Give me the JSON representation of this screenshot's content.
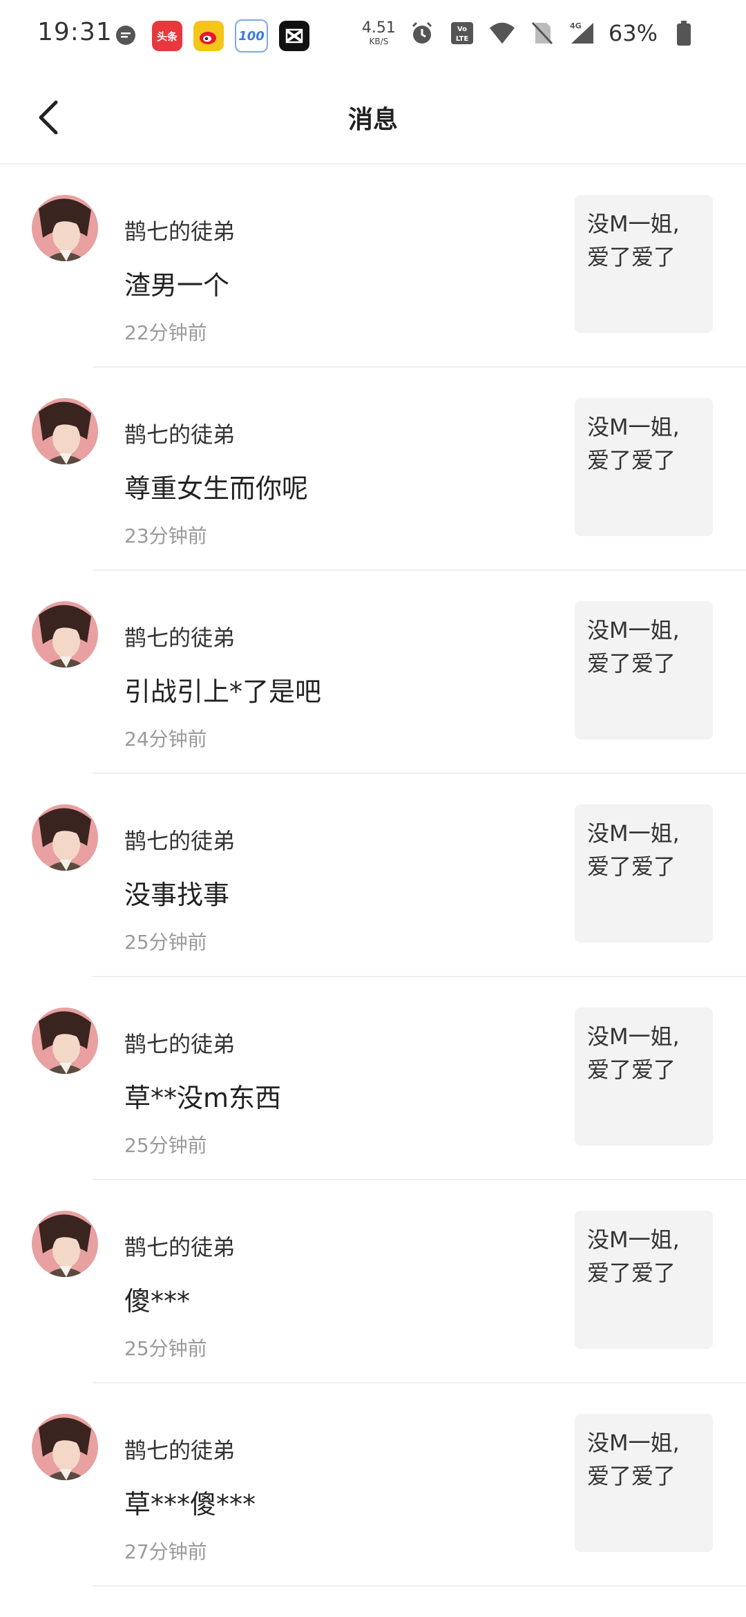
{
  "status_bar": {
    "time": "19:31",
    "net_speed_value": "4.51",
    "net_speed_unit": "KB/S",
    "battery": "63%",
    "app_icons": [
      "message-icon",
      "toutiao-icon",
      "weibo-icon",
      "baidu-100-icon",
      "capcut-icon"
    ],
    "app_labels": {
      "toutiao": "头条",
      "baidu": "100"
    }
  },
  "header": {
    "title": "消息"
  },
  "messages": [
    {
      "username": "鹊七的徒弟",
      "comment": "渣男一个",
      "time": "22分钟前",
      "quote_line1": "没M一姐,",
      "quote_line2": "爱了爱了"
    },
    {
      "username": "鹊七的徒弟",
      "comment": "尊重女生而你呢",
      "time": "23分钟前",
      "quote_line1": "没M一姐,",
      "quote_line2": "爱了爱了"
    },
    {
      "username": "鹊七的徒弟",
      "comment": "引战引上*了是吧",
      "time": "24分钟前",
      "quote_line1": "没M一姐,",
      "quote_line2": "爱了爱了"
    },
    {
      "username": "鹊七的徒弟",
      "comment": "没事找事",
      "time": "25分钟前",
      "quote_line1": "没M一姐,",
      "quote_line2": "爱了爱了"
    },
    {
      "username": "鹊七的徒弟",
      "comment": "草**没m东西",
      "time": "25分钟前",
      "quote_line1": "没M一姐,",
      "quote_line2": "爱了爱了"
    },
    {
      "username": "鹊七的徒弟",
      "comment": "傻***",
      "time": "25分钟前",
      "quote_line1": "没M一姐,",
      "quote_line2": "爱了爱了"
    },
    {
      "username": "鹊七的徒弟",
      "comment": "草***傻***",
      "time": "27分钟前",
      "quote_line1": "没M一姐,",
      "quote_line2": "爱了爱了"
    }
  ],
  "colors": {
    "timestamp": "#9a9a9a",
    "quote_bg": "#f3f3f3",
    "divider": "#efefef"
  }
}
